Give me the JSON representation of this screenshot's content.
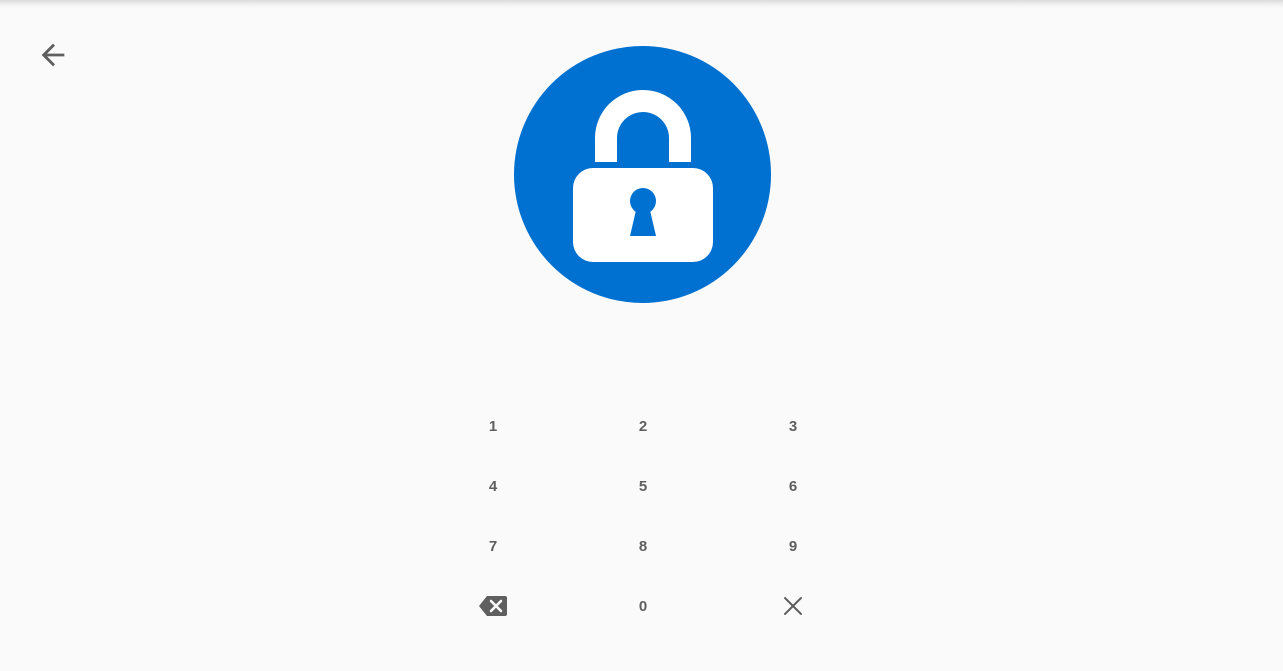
{
  "header": {
    "back_icon": "arrow-left-icon"
  },
  "lock": {
    "icon": "lock-icon",
    "circle_color": "#0071d1",
    "glyph_color": "#ffffff"
  },
  "keypad": {
    "rows": [
      [
        {
          "label": "1"
        },
        {
          "label": "2"
        },
        {
          "label": "3"
        }
      ],
      [
        {
          "label": "4"
        },
        {
          "label": "5"
        },
        {
          "label": "6"
        }
      ],
      [
        {
          "label": "7"
        },
        {
          "label": "8"
        },
        {
          "label": "9"
        }
      ],
      [
        {
          "icon": "backspace-icon"
        },
        {
          "label": "0"
        },
        {
          "icon": "close-icon"
        }
      ]
    ],
    "text_color": "#5f5f5f"
  }
}
